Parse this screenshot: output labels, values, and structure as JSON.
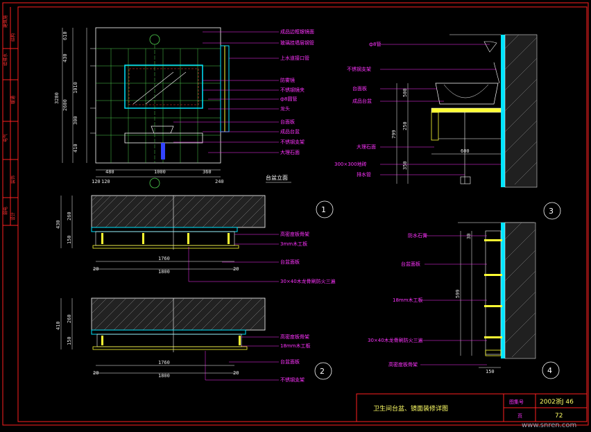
{
  "sidebar": {
    "items": [
      "建筑施",
      "结构",
      "给排水",
      "暖通",
      "电气",
      "装饰",
      "弱电",
      "设计"
    ]
  },
  "views": {
    "elevation_title": "台盆立面",
    "view_numbers": [
      "1",
      "2",
      "3",
      "4"
    ]
  },
  "elevation": {
    "labels": [
      "成品边框银镜面",
      "玻璃挂墙层钢管",
      "上水道接口管",
      "防雾镜",
      "不锈钢镜夹",
      "ф8圆管",
      "龙头",
      "台面板",
      "成品台盆",
      "不锈钢支架",
      "大理石面"
    ],
    "dims_left": [
      "610",
      "430",
      "1010",
      "300",
      "410",
      "2600",
      "3280"
    ],
    "dims_bottom": [
      "480",
      "1000",
      "360",
      "120",
      "120",
      "240"
    ]
  },
  "plan1": {
    "labels": [
      "高密度板骨架",
      "3mm木工板",
      "台盆面板",
      "30×40木龙骨刷防火三遍"
    ],
    "dims": [
      "430",
      "260",
      "150",
      "1760",
      "1800",
      "20",
      "20"
    ]
  },
  "plan2": {
    "labels": [
      "高密度板骨架",
      "18mm木工板",
      "台盆面板",
      "不锈钢支架"
    ],
    "dims": [
      "410",
      "260",
      "150",
      "1760",
      "1800",
      "20",
      "20"
    ]
  },
  "section3": {
    "labels": [
      "ф8管",
      "不锈钢支架",
      "台面板",
      "成品台盆",
      "大理石面",
      "300×300地砖",
      "排水管"
    ],
    "dims": [
      "500",
      "250",
      "799",
      "350",
      "600"
    ]
  },
  "section4": {
    "labels": [
      "防水石膏",
      "台盆面板",
      "18mm木工板",
      "30×40木龙骨刷防火三遍",
      "高密度板骨架"
    ],
    "dims": [
      "30",
      "599",
      "150"
    ]
  },
  "title_block": {
    "title": "卫生间台盆、镜面装修详图",
    "drawing_no_label": "图集号",
    "drawing_no": "2002浙J 46",
    "page_label": "页",
    "page": "72"
  },
  "watermark": "www.snren.com",
  "colors": {
    "frame": "#ff2020",
    "lines": "#ffffff",
    "cyan": "#00e5ff",
    "text": "#ff33ff",
    "yellow": "#ffff33"
  }
}
